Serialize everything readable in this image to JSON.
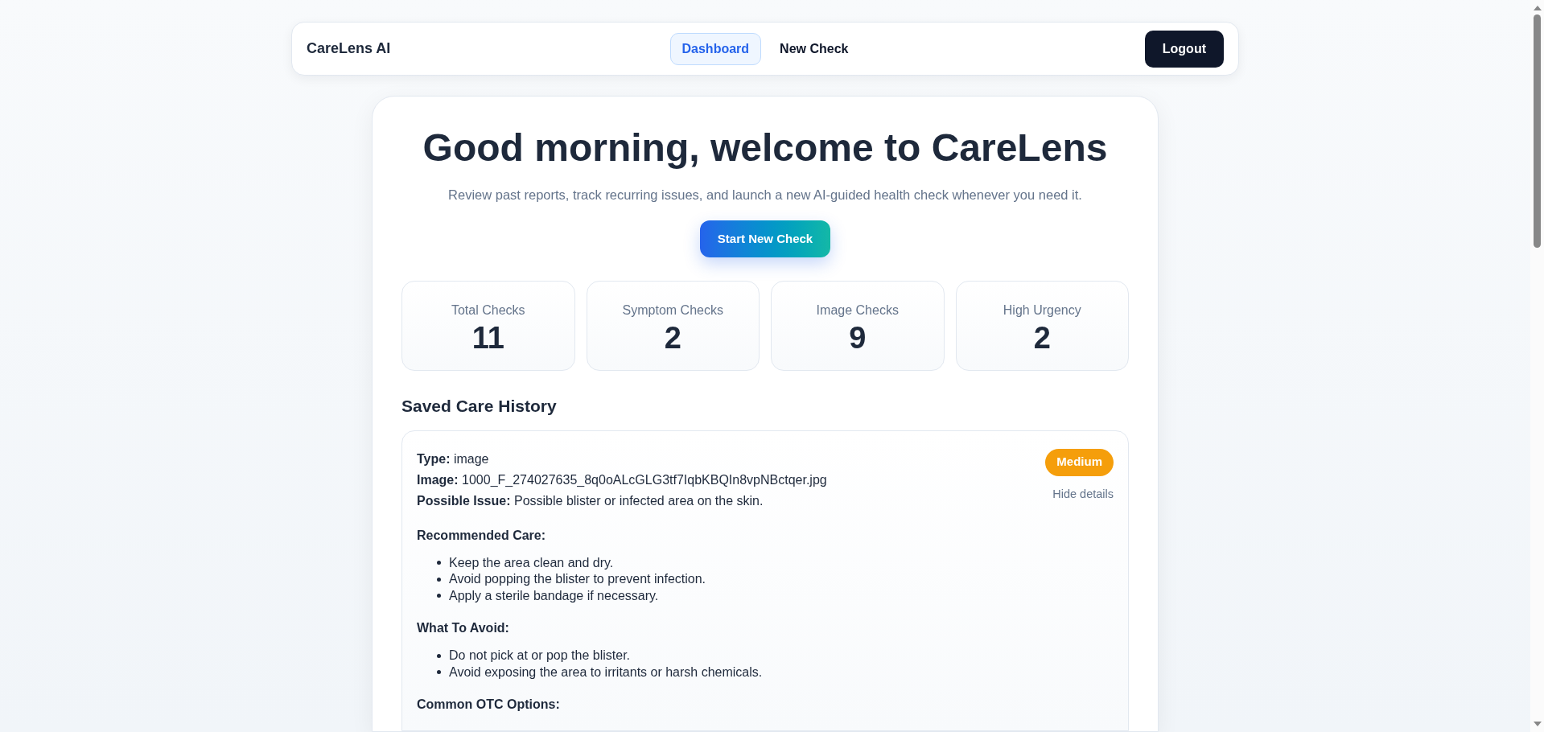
{
  "nav": {
    "brand": "CareLens AI",
    "links": [
      {
        "label": "Dashboard",
        "selected": true
      },
      {
        "label": "New Check",
        "selected": false
      }
    ],
    "logout": "Logout"
  },
  "hero": {
    "title": "Good morning, welcome to CareLens",
    "subtitle": "Review past reports, track recurring issues, and launch a new AI-guided health check whenever you need it.",
    "button": "Start New Check"
  },
  "stats": [
    {
      "label": "Total Checks",
      "value": "11"
    },
    {
      "label": "Symptom Checks",
      "value": "2"
    },
    {
      "label": "Image Checks",
      "value": "9"
    },
    {
      "label": "High Urgency",
      "value": "2"
    }
  ],
  "history": {
    "heading": "Saved Care History",
    "entries": [
      {
        "fields": [
          {
            "label": "Type:",
            "value": "image"
          },
          {
            "label": "Image:",
            "value": "1000_F_274027635_8q0oALcGLG3tf7IqbKBQIn8vpNBctqer.jpg"
          },
          {
            "label": "Possible Issue:",
            "value": "Possible blister or infected area on the skin."
          }
        ],
        "urgency": "Medium",
        "color": "#f59e0b",
        "toggle": "Hide details",
        "expanded": true,
        "sections": [
          {
            "title": "Recommended Care:",
            "items": [
              "Keep the area clean and dry.",
              "Avoid popping the blister to prevent infection.",
              "Apply a sterile bandage if necessary."
            ]
          },
          {
            "title": "What To Avoid:",
            "items": [
              "Do not pick at or pop the blister.",
              "Avoid exposing the area to irritants or harsh chemicals."
            ]
          },
          {
            "title": "Common OTC Options:"
          }
        ]
      }
    ]
  }
}
